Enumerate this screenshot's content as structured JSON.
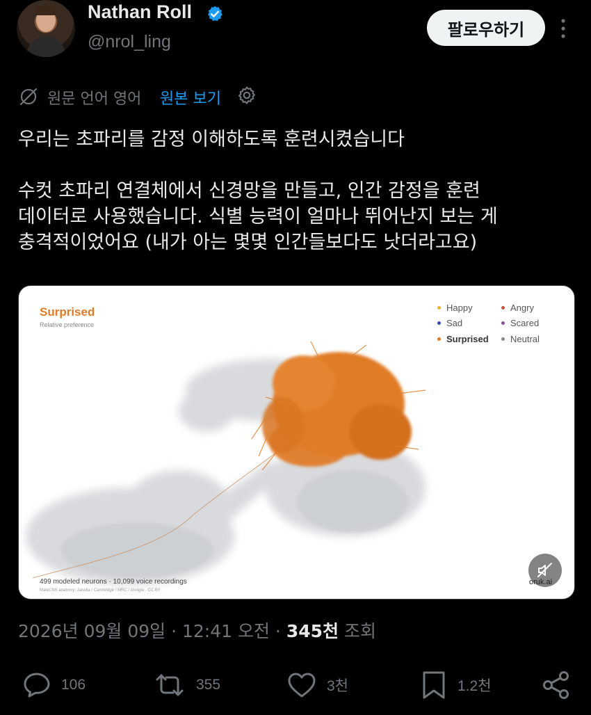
{
  "author": {
    "name": "Nathan Roll",
    "handle": "@nrol_ling",
    "verified": true,
    "avatar_icon": "profile-photo"
  },
  "header": {
    "follow_label": "팔로우하기",
    "more_icon": "vertical-ellipsis-icon"
  },
  "translation": {
    "label": "원문 언어 영어",
    "link": "원본 보기",
    "icon": "translate-off-icon",
    "settings_icon": "gear-icon"
  },
  "tweet": {
    "headline": "우리는 초파리를 감정 이해하도록 훈련시켰습니다",
    "body_lines": [
      "수컷 초파리 연결체에서 신경망을 만들고, 인간 감정을 훈련",
      "데이터로 사용했습니다. 식별 능력이 얼마나 뛰어난지 보는 게",
      "충격적이었어요 (내가 아는 몇몇 인간들보다도 낫더라고요)"
    ]
  },
  "media": {
    "title": "Surprised",
    "subtitle": "Relative preference",
    "legend": [
      {
        "label": "Happy",
        "color": "#e8b33a",
        "active": false
      },
      {
        "label": "Angry",
        "color": "#c0543f",
        "active": false
      },
      {
        "label": "Sad",
        "color": "#3a4bb0",
        "active": false
      },
      {
        "label": "Scared",
        "color": "#8a4f9e",
        "active": false
      },
      {
        "label": "Surprised",
        "color": "#e07b26",
        "active": true
      },
      {
        "label": "Neutral",
        "color": "#888888",
        "active": false
      }
    ],
    "footer_stats": "499 modeled neurons · 10,099 voice recordings",
    "footer_credit": "MaleCNS anatomy: Janelia / Cambridge / MRC / Google · CC BY",
    "watermark": "oruk.ai",
    "mute_icon": "speaker-muted-icon",
    "highlight_color": "#e07b26"
  },
  "meta": {
    "timestamp": "2026년 09월 09일 · 12:41 오전 · ",
    "views_count": "345천",
    "views_label": " 조회"
  },
  "actions": {
    "reply": {
      "icon": "reply-icon",
      "count": "106"
    },
    "repost": {
      "icon": "repost-icon",
      "count": "355"
    },
    "like": {
      "icon": "heart-icon",
      "count": "3천"
    },
    "bookmark": {
      "icon": "bookmark-icon",
      "count": "1.2천"
    },
    "share": {
      "icon": "share-icon"
    }
  }
}
